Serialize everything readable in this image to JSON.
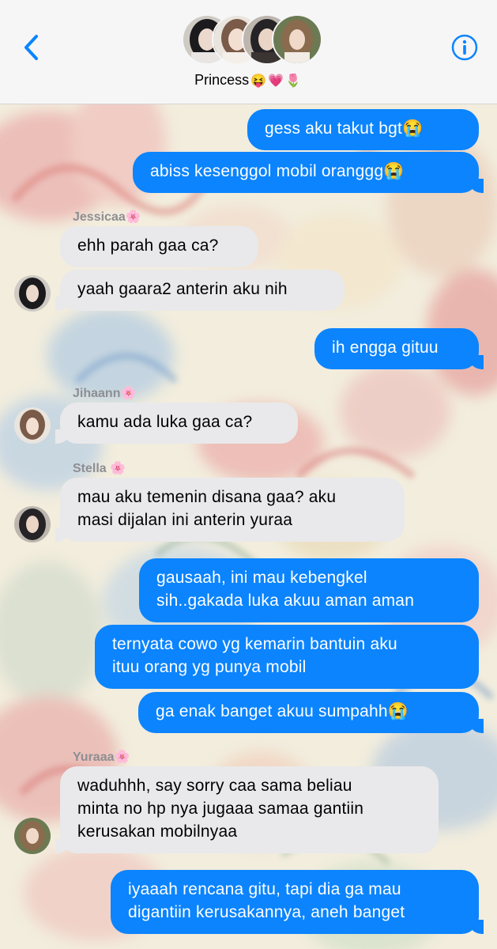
{
  "header": {
    "group_name": "Princess",
    "group_emojis": "😝💗🌷",
    "back_icon": "chevron-left-icon",
    "info_icon": "info-icon"
  },
  "colors": {
    "outgoing_bubble": "#0b84fe",
    "incoming_bubble": "#e9e9eb",
    "accent": "#0b84fe",
    "sender_label": "#8e8e93"
  },
  "senders": {
    "jessica": "Jessicaa🌸",
    "jihaan": "Jihaann🌸",
    "stella": "Stella 🌸",
    "yura": "Yuraaa🌸"
  },
  "messages": [
    {
      "from": "me",
      "text": "gess aku takut bgt😭"
    },
    {
      "from": "me",
      "text": "abiss kesenggol mobil oranggg😭"
    },
    {
      "from": "Jessicaa",
      "text": "ehh parah gaa ca?"
    },
    {
      "from": "Jessicaa",
      "text": "yaah gaara2 anterin aku nih"
    },
    {
      "from": "me",
      "text": "ih engga gituu"
    },
    {
      "from": "Jihaann",
      "text": "kamu ada luka gaa ca?"
    },
    {
      "from": "Stella",
      "text": "mau aku temenin disana gaa? aku\nmasi dijalan ini anterin yuraa"
    },
    {
      "from": "me",
      "text": "gausaah, ini mau kebengkel\nsih..gakada luka akuu aman aman"
    },
    {
      "from": "me",
      "text": "ternyata cowo yg kemarin bantuin aku\nituu orang yg punya mobil"
    },
    {
      "from": "me",
      "text": "ga enak banget akuu sumpahh😭"
    },
    {
      "from": "Yuraaa",
      "text": "waduhhh, say sorry caa sama beliau\nminta no hp nya jugaaa samaa gantiin\nkerusakan mobilnyaa"
    },
    {
      "from": "me",
      "text": "iyaaah rencana gitu, tapi dia ga mau\ndigantiin kerusakannya, aneh banget"
    }
  ]
}
